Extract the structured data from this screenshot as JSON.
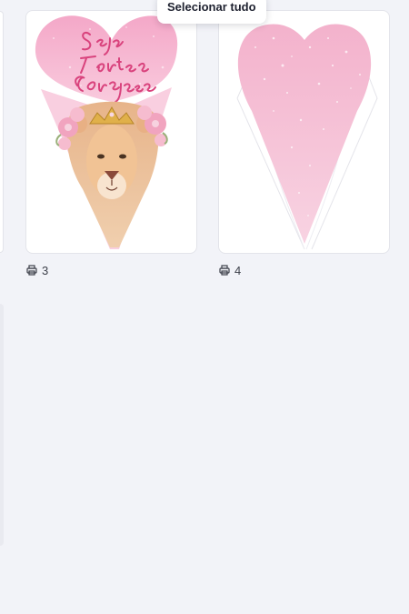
{
  "tooltip": {
    "label": "Selecionar tudo"
  },
  "pages": [
    {
      "number": "3",
      "design": "Seja Forte e Corajosa",
      "icon": "print-icon"
    },
    {
      "number": "4",
      "design": "",
      "icon": "print-icon"
    }
  ],
  "colors": {
    "canvas": "#f2f3f8",
    "card": "#ffffff",
    "pink_light": "#f7c6da",
    "pink": "#ee9fc1",
    "script_text": "#d9437d"
  }
}
